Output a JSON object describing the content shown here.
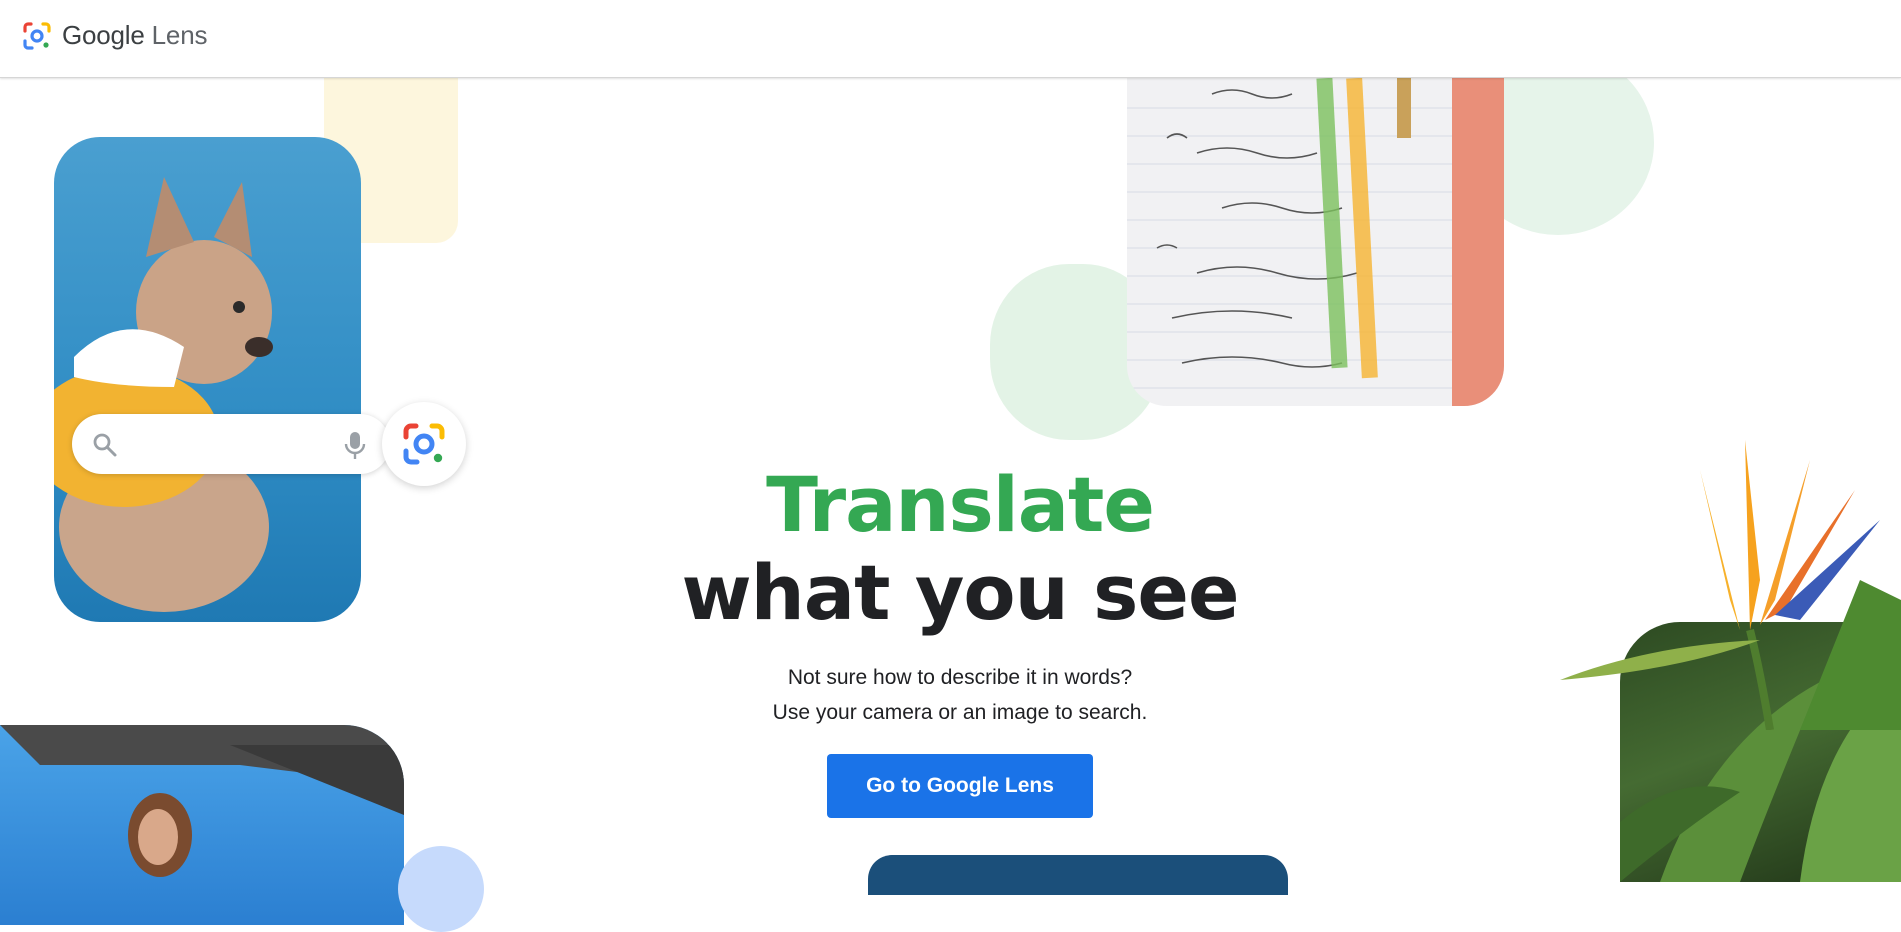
{
  "header": {
    "brand": "Google",
    "product": "Lens"
  },
  "hero": {
    "title_accent": "Translate",
    "title_main": "what you see",
    "subtitle_line1": "Not sure how to describe it in words?",
    "subtitle_line2": "Use your camera or an image to search.",
    "cta_label": "Go to Google Lens"
  },
  "colors": {
    "accent_green": "#34a853",
    "cta_blue": "#1a73e8",
    "text_dark": "#202124"
  },
  "icons": {
    "logo": "google-lens-logo-icon",
    "search": "search-icon",
    "mic": "mic-icon",
    "lens": "google-lens-icon"
  }
}
